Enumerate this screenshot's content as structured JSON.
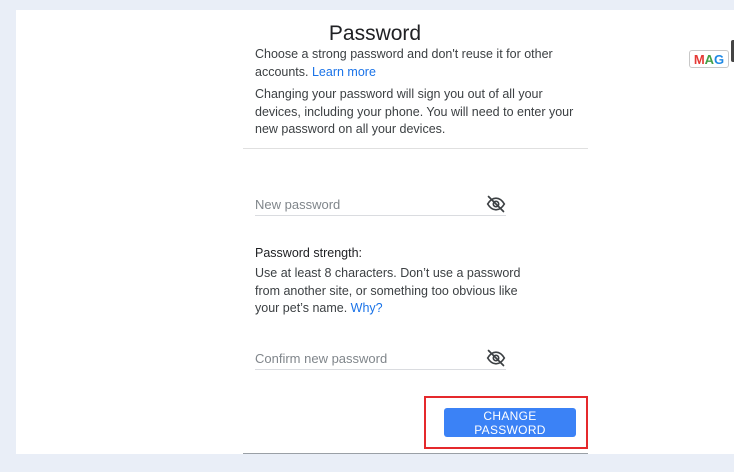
{
  "page": {
    "title": "Password"
  },
  "intro": {
    "text": "Choose a strong password and don't reuse it for other accounts. ",
    "link": "Learn more"
  },
  "warning": {
    "text": "Changing your password will sign you out of all your devices, including your phone. You will need to enter your new password on all your devices."
  },
  "new_password": {
    "value": "",
    "placeholder": "New password",
    "toggle_icon": "eye-off-icon"
  },
  "strength": {
    "label": "Password strength:",
    "text": "Use at least 8 characters. Don’t use a password from another site, or something too obvious like your pet’s name. ",
    "link": "Why?"
  },
  "confirm_password": {
    "value": "",
    "placeholder": "Confirm new password",
    "toggle_icon": "eye-off-icon"
  },
  "actions": {
    "change_label": "CHANGE PASSWORD",
    "highlight_color": "#e5292c",
    "button_color": "#3b82f6"
  },
  "watermark": {
    "text": "MAG"
  }
}
